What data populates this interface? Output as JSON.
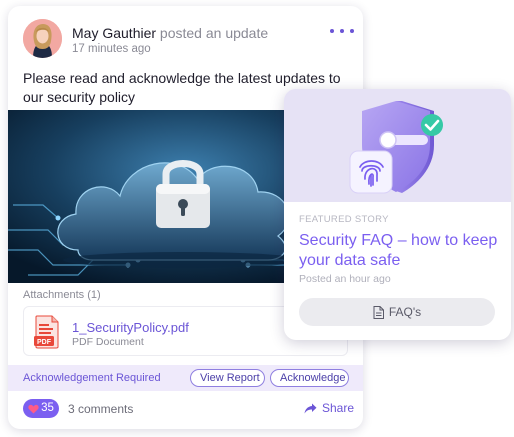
{
  "post": {
    "author": "May Gauthier",
    "action": " posted an update",
    "time": "17 minutes ago",
    "body": "Please read and acknowledge the latest updates to our security policy",
    "more_icon": "more-horizontal-icon",
    "image_icon": "cloud-lock-icon",
    "attachments_label": "Attachments (1)",
    "attachment": {
      "name": "1_SecurityPolicy.pdf",
      "type": "PDF Document",
      "icon": "pdf-file-icon",
      "badge": "PDF"
    },
    "acknowledgement": {
      "label": "Acknowledgement Required",
      "view_report": "View Report",
      "acknowledge": "Acknowledge"
    },
    "likes": "35",
    "like_icon": "heart-icon",
    "comments": "3 comments",
    "share": "Share",
    "share_icon": "share-arrow-icon"
  },
  "story": {
    "kicker": "Featured Story",
    "title": "Security FAQ – how to keep your data safe",
    "time": "Posted an hour ago",
    "button": "FAQ's",
    "button_icon": "document-icon",
    "hero_icon": "shield-check-fingerprint-icon"
  },
  "colors": {
    "accent": "#7b5ff0",
    "accent_dark": "#6b55d6",
    "ack_bar": "#efeafb",
    "hero_bg": "#e6e2f5",
    "pdf_red": "#e8483a"
  }
}
